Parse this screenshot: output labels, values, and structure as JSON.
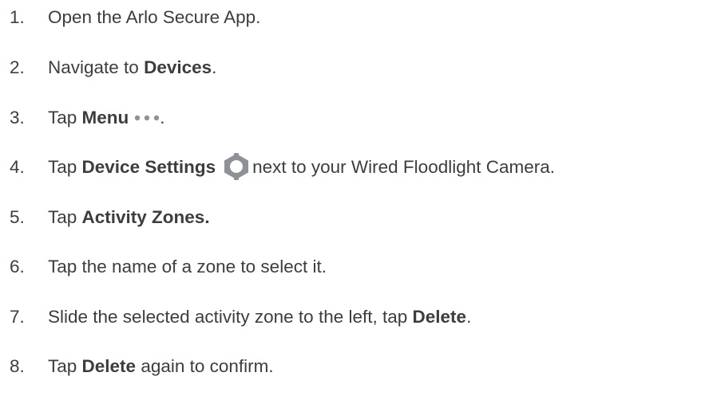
{
  "steps": [
    {
      "number": "1.",
      "segments": [
        "Open the Arlo Secure App."
      ]
    },
    {
      "number": "2.",
      "segments": [
        "Navigate to ",
        "Devices",
        "."
      ]
    },
    {
      "number": "3.",
      "segments": [
        "Tap ",
        "Menu",
        "."
      ],
      "icon": "more-dots-icon"
    },
    {
      "number": "4.",
      "segments": [
        "Tap ",
        "Device Settings",
        "next to your Wired Floodlight Camera."
      ],
      "icon": "gear-icon"
    },
    {
      "number": "5.",
      "segments": [
        "Tap ",
        "Activity Zones."
      ]
    },
    {
      "number": "6.",
      "segments": [
        "Tap the name of a zone to select it."
      ]
    },
    {
      "number": "7.",
      "segments": [
        "Slide the selected activity zone to the left, tap ",
        "Delete",
        "."
      ]
    },
    {
      "number": "8.",
      "segments": [
        "Tap ",
        "Delete",
        " again to confirm."
      ]
    }
  ],
  "colors": {
    "text": "#3d3d3d",
    "icon": "#8e9196"
  }
}
